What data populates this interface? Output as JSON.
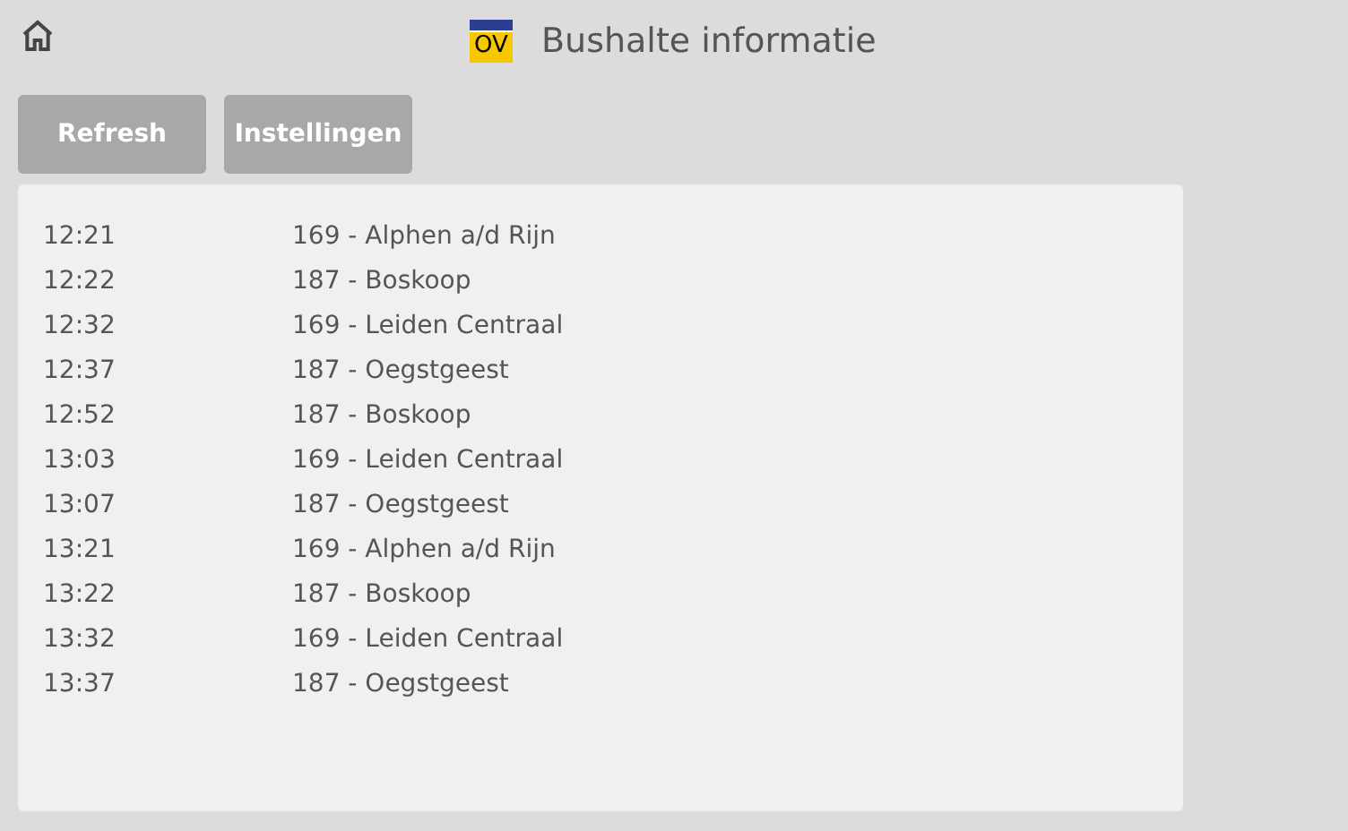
{
  "header": {
    "logo_text": "OV",
    "title": "Bushalte informatie"
  },
  "buttons": [
    "Refresh",
    "Instellingen"
  ],
  "departures": [
    {
      "time": "12:21",
      "route": "169 - Alphen a/d Rijn"
    },
    {
      "time": "12:22",
      "route": "187 - Boskoop"
    },
    {
      "time": "12:32",
      "route": "169 - Leiden Centraal"
    },
    {
      "time": "12:37",
      "route": "187 - Oegstgeest"
    },
    {
      "time": "12:52",
      "route": "187 - Boskoop"
    },
    {
      "time": "13:03",
      "route": "169 - Leiden Centraal"
    },
    {
      "time": "13:07",
      "route": "187 - Oegstgeest"
    },
    {
      "time": "13:21",
      "route": "169 - Alphen a/d Rijn"
    },
    {
      "time": "13:22",
      "route": "187 - Boskoop"
    },
    {
      "time": "13:32",
      "route": "169 - Leiden Centraal"
    },
    {
      "time": "13:37",
      "route": "187 - Oegstgeest"
    }
  ]
}
